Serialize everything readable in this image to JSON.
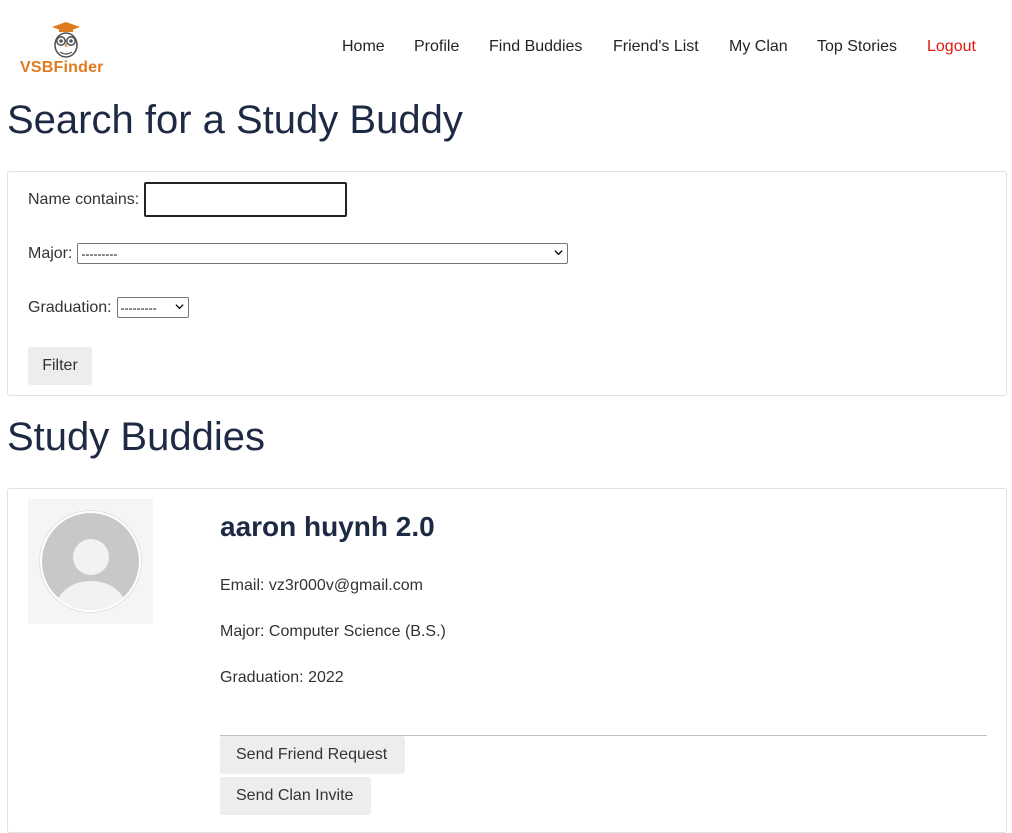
{
  "brand": {
    "name": "VSBFinder",
    "icon": "owl-logo-icon",
    "color": "#e07a1f"
  },
  "nav": {
    "items": [
      {
        "label": "Home"
      },
      {
        "label": "Profile"
      },
      {
        "label": "Find Buddies"
      },
      {
        "label": "Friend's List"
      },
      {
        "label": "My Clan"
      },
      {
        "label": "Top Stories"
      }
    ],
    "logout": {
      "label": "Logout",
      "color": "#e0190c"
    }
  },
  "search": {
    "title": "Search for a Study Buddy",
    "name_label": "Name contains:",
    "name_value": "",
    "major_label": "Major:",
    "major_selected": "---------",
    "graduation_label": "Graduation:",
    "graduation_selected": "---------",
    "filter_button": "Filter"
  },
  "results": {
    "title": "Study Buddies",
    "buddies": [
      {
        "name": "aaron huynh 2.0",
        "email_label": "Email:",
        "email": "vz3r000v@gmail.com",
        "major_label": "Major:",
        "major": "Computer Science (B.S.)",
        "graduation_label": "Graduation:",
        "graduation": "2022",
        "avatar_icon": "default-avatar-icon",
        "friend_button": "Send Friend Request",
        "clan_button": "Send Clan Invite"
      }
    ]
  },
  "colors": {
    "heading": "#1e2a44",
    "button_bg": "#ededed",
    "card_border": "#dfe2e5"
  }
}
